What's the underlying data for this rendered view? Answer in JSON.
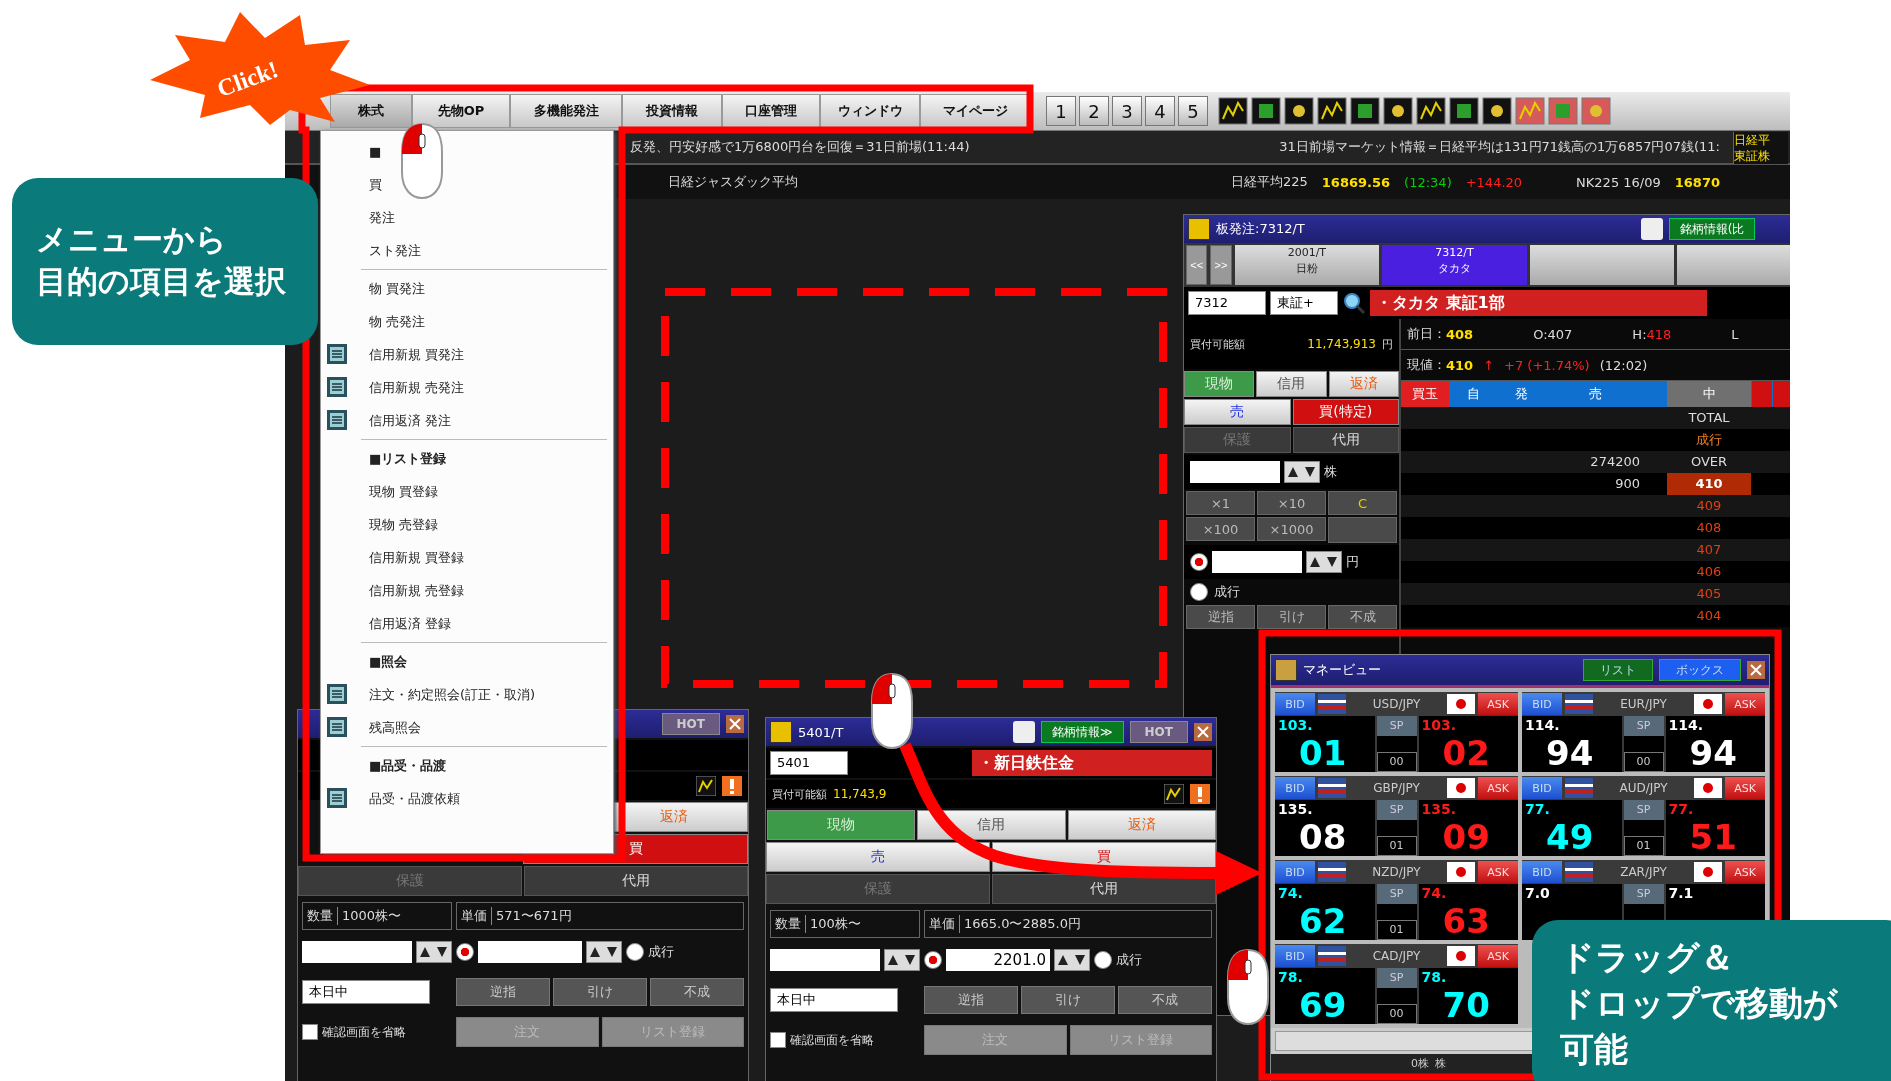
{
  "annotations": {
    "click_label": "Click!",
    "menu_callout": [
      "メニューから",
      "目的の項目を選択"
    ],
    "drag_callout": [
      "ドラッグ＆",
      "ドロップで移動が",
      "可能"
    ]
  },
  "menubar": {
    "menus": [
      {
        "label": "株式",
        "selected": true
      },
      {
        "label": "先物OP",
        "selected": false
      },
      {
        "label": "多機能発注",
        "selected": false
      },
      {
        "label": "投資情報",
        "selected": false
      },
      {
        "label": "口座管理",
        "selected": false
      },
      {
        "label": "ウィンドウ",
        "selected": false
      },
      {
        "label": "マイページ",
        "selected": false
      }
    ],
    "page_buttons": [
      "1",
      "2",
      "3",
      "4",
      "5"
    ]
  },
  "ticker": {
    "headline_left": "反発、円安好感で1万6800円台を回復＝31日前場(11:44)",
    "headline_right": "31日前場マーケット情報＝日経平均は131円71銭高の1万6857円07銭(11:",
    "side_label": [
      "日経平",
      "東証株"
    ]
  },
  "indices": {
    "jasdaq_name": "日経ジャスダック平均",
    "nikkei_name": "日経平均225",
    "nikkei_value": "16869.56",
    "nikkei_time": "(12:34)",
    "nikkei_change": "+144.20",
    "futures_name": "NK225 16/09",
    "futures_value": "16870"
  },
  "dropdown": [
    {
      "kind": "header",
      "text": "■",
      "icon": false
    },
    {
      "kind": "item",
      "text": "買",
      "icon": false
    },
    {
      "kind": "item",
      "text": "発注",
      "icon": false
    },
    {
      "kind": "item",
      "text": "スト発注",
      "icon": false
    },
    {
      "kind": "header-less",
      "text": "物 買発注",
      "icon": false
    },
    {
      "kind": "item",
      "text": "物 売発注",
      "icon": false
    },
    {
      "kind": "item",
      "text": "信用新規 買発注",
      "icon": true
    },
    {
      "kind": "item",
      "text": "信用新規 売発注",
      "icon": true
    },
    {
      "kind": "item",
      "text": "信用返済 発注",
      "icon": true
    },
    {
      "kind": "header",
      "text": "■リスト登録",
      "icon": false
    },
    {
      "kind": "item",
      "text": "現物 買登録",
      "icon": false
    },
    {
      "kind": "item",
      "text": "現物 売登録",
      "icon": false
    },
    {
      "kind": "item",
      "text": "信用新規 買登録",
      "icon": false
    },
    {
      "kind": "item",
      "text": "信用新規 売登録",
      "icon": false
    },
    {
      "kind": "item",
      "text": "信用返済 登録",
      "icon": false
    },
    {
      "kind": "header",
      "text": "■照会",
      "icon": false
    },
    {
      "kind": "item",
      "text": "注文・約定照会(訂正・取消)",
      "icon": true
    },
    {
      "kind": "item",
      "text": "残高照会",
      "icon": true
    },
    {
      "kind": "header",
      "text": "■品受・品渡",
      "icon": false
    },
    {
      "kind": "item",
      "text": "品受・品渡依頼",
      "icon": true
    }
  ],
  "order_board": {
    "title": "板発注:7312/T",
    "info_button": "銘柄情報(比",
    "nav": [
      "<<",
      ">>"
    ],
    "stock_tabs": [
      {
        "code": "2001/T",
        "name": "日粉",
        "selected": false
      },
      {
        "code": "7312/T",
        "name": "タカタ",
        "selected": true
      }
    ],
    "code": "7312",
    "market": "東証+",
    "name": "・タカタ 東証1部",
    "power_label": "買付可能額",
    "power_value": "11,743,913",
    "power_unit": "円",
    "prev_label": "前日：",
    "prev": "408",
    "open_label": "O:",
    "open": "407",
    "high_label": "H:",
    "high": "418",
    "low_label": "L",
    "price_label": "現値：",
    "price": "410",
    "arrow": "↑",
    "change": "+7 (+1.74%)",
    "time": "(12:02)",
    "trade_tabs": [
      {
        "label": "現物",
        "selected": true
      },
      {
        "label": "信用",
        "selected": false
      },
      {
        "label": "返済",
        "selected": false
      }
    ],
    "side_buttons": [
      {
        "label": "売",
        "selected": false
      },
      {
        "label": "買(特定)",
        "selected": true
      }
    ],
    "account_buttons": [
      "保護",
      "代用"
    ],
    "qty_unit": "株",
    "multipliers": [
      "×1",
      "×10",
      "C",
      "×100",
      "×1000"
    ],
    "price_unit": "円",
    "limit_selected": true,
    "market_order": {
      "label": "成行",
      "selected": false
    },
    "cond_buttons": [
      "逆指",
      "引け",
      "不成"
    ],
    "book_headers": [
      "買玉",
      "自",
      "発",
      "売",
      "中"
    ],
    "book_rows": [
      {
        "kind": "label",
        "qty": "",
        "label": "TOTAL"
      },
      {
        "kind": "market",
        "qty": "",
        "label": "成行"
      },
      {
        "kind": "label",
        "qty": "274200",
        "label": "OVER"
      },
      {
        "kind": "current",
        "qty": "900",
        "label": "410"
      },
      {
        "kind": "ask",
        "qty": "",
        "label": "409"
      },
      {
        "kind": "ask",
        "qty": "",
        "label": "408"
      },
      {
        "kind": "ask",
        "qty": "",
        "label": "407"
      },
      {
        "kind": "ask",
        "qty": "",
        "label": "406"
      },
      {
        "kind": "ask",
        "qty": "",
        "label": "405"
      },
      {
        "kind": "ask",
        "qty": "",
        "label": "404"
      }
    ]
  },
  "money_view": {
    "title": "マネービュー",
    "buttons": [
      {
        "label": "リスト",
        "selected": false
      },
      {
        "label": "ボックス",
        "selected": true
      }
    ],
    "pairs": [
      {
        "pair": "USD/JPY",
        "bid_label": "BID",
        "ask_label": "ASK",
        "sp_label": "SP",
        "bid": {
          "head": "103.",
          "pips": "01",
          "color": "#00ffff"
        },
        "spread": "00",
        "ask": {
          "head": "103.",
          "pips": "02",
          "color": "#ff1a1a"
        }
      },
      {
        "pair": "EUR/JPY",
        "bid_label": "BID",
        "ask_label": "ASK",
        "sp_label": "SP",
        "bid": {
          "head": "114.",
          "pips": "94",
          "color": "#ffffff"
        },
        "spread": "00",
        "ask": {
          "head": "114.",
          "pips": "94",
          "color": "#ffffff"
        }
      },
      {
        "pair": "GBP/JPY",
        "bid_label": "BID",
        "ask_label": "ASK",
        "sp_label": "SP",
        "bid": {
          "head": "135.",
          "pips": "08",
          "color": "#ffffff"
        },
        "spread": "01",
        "ask": {
          "head": "135.",
          "pips": "09",
          "color": "#ff1a1a"
        }
      },
      {
        "pair": "AUD/JPY",
        "bid_label": "BID",
        "ask_label": "ASK",
        "sp_label": "SP",
        "bid": {
          "head": "77.",
          "pips": "49",
          "color": "#00ffff"
        },
        "spread": "01",
        "ask": {
          "head": "77.",
          "pips": "51",
          "color": "#ff1a1a"
        }
      },
      {
        "pair": "NZD/JPY",
        "bid_label": "BID",
        "ask_label": "ASK",
        "sp_label": "SP",
        "bid": {
          "head": "74.",
          "pips": "62",
          "color": "#00ffff"
        },
        "spread": "01",
        "ask": {
          "head": "74.",
          "pips": "63",
          "color": "#ff1a1a"
        }
      },
      {
        "pair": "ZAR/JPY",
        "bid_label": "BID",
        "ask_label": "ASK",
        "sp_label": "SP",
        "bid": {
          "head": "7.0",
          "color": "#ffffff"
        },
        "ask": {
          "head": "7.1",
          "color": "#ffffff"
        }
      },
      {
        "pair": "CAD/JPY",
        "bid_label": "BID",
        "ask_label": "ASK",
        "sp_label": "SP",
        "bid": {
          "head": "78.",
          "pips": "69",
          "color": "#00ffff"
        },
        "spread": "00",
        "ask": {
          "head": "78.",
          "pips": "70",
          "color": "#00ffff"
        }
      }
    ],
    "status_texts": [
      "0株",
      "株"
    ]
  },
  "order_windows": [
    {
      "hot_button": "HOT",
      "trade_tabs": [
        {
          "label": "返済",
          "selected": false
        }
      ],
      "side_buttons": [
        {
          "label": "買",
          "selected": true
        }
      ],
      "account_buttons": [
        "保護",
        "代用"
      ],
      "qty_label": "数量",
      "qty_range": "1000株〜",
      "price_label": "単価",
      "price_range": "571〜671円",
      "limit_selected": true,
      "market_order": {
        "label": "成行",
        "selected": false
      },
      "period": "本日中",
      "cond_buttons": [
        "逆指",
        "引け",
        "不成"
      ],
      "skip_confirm": {
        "label": "確認画面を省略",
        "checked": false
      },
      "order_button": "注文",
      "list_button": "リスト登録"
    },
    {
      "title": "5401/T",
      "info_button": "銘柄情報≫",
      "hot_button": "HOT",
      "code": "5401",
      "name": "・新日鉄住金",
      "power_label": "買付可能額",
      "power_value": "11,743,9",
      "trade_tabs": [
        {
          "label": "現物",
          "selected": true
        },
        {
          "label": "信用",
          "selected": false
        },
        {
          "label": "返済",
          "selected": false
        }
      ],
      "side_buttons": [
        {
          "label": "売",
          "selected": false
        },
        {
          "label": "買",
          "selected": false
        }
      ],
      "account_buttons": [
        "保護",
        "代用"
      ],
      "qty_label": "数量",
      "qty_range": "100株〜",
      "price_label": "単価",
      "price_range": "1665.0〜2885.0円",
      "price_value": "2201.0",
      "limit_selected": true,
      "market_order": {
        "label": "成行",
        "selected": false
      },
      "period": "本日中",
      "cond_buttons": [
        "逆指",
        "引け",
        "不成"
      ],
      "skip_confirm": {
        "label": "確認画面を省略",
        "checked": false
      },
      "order_button": "注文",
      "list_button": "リスト登録"
    }
  ]
}
